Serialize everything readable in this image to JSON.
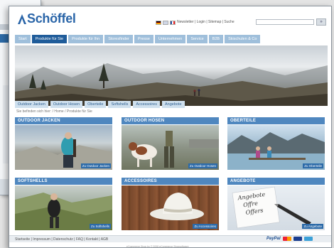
{
  "header": {
    "brand": "Schöffel",
    "util_links": "Newsletter | Login | Sitemap | Suche",
    "search_placeholder": "",
    "search_button": "»"
  },
  "nav": {
    "items": [
      {
        "label": "Start"
      },
      {
        "label": "Produkte für Sie"
      },
      {
        "label": "Produkte für Ihn"
      },
      {
        "label": "Storesfinder"
      },
      {
        "label": "Presse"
      },
      {
        "label": "Unternehmen"
      },
      {
        "label": "Service"
      },
      {
        "label": "B2B"
      },
      {
        "label": "Skischulen & Co"
      }
    ],
    "active_index": 1
  },
  "sub_nav": {
    "items": [
      {
        "label": "Outdoor Jacken"
      },
      {
        "label": "Outdoor Hosen"
      },
      {
        "label": "Oberteile"
      },
      {
        "label": "Softshells"
      },
      {
        "label": "Accessoires"
      },
      {
        "label": "Angebote"
      }
    ]
  },
  "breadcrumb": "Sie befinden sich hier: / Home / Produkte für Sie",
  "tiles": [
    {
      "title": "OUTDOOR JACKEN",
      "link": "Zu Outdoor Jacken"
    },
    {
      "title": "OUTDOOR HOSEN",
      "link": "Zu Outdoor Hosen"
    },
    {
      "title": "OBERTEILE",
      "link": "Zu Oberteile"
    },
    {
      "title": "SOFTSHELLS",
      "link": "Zu Softshells"
    },
    {
      "title": "ACCESSOIRES",
      "link": "Zu Accessoires"
    },
    {
      "title": "ANGEBOTE",
      "link": "Zu Angebote",
      "sign_lines": [
        "Angebote",
        "Offre",
        "Offers"
      ]
    }
  ],
  "footer": {
    "links": "Startseite | Impressum | Datenschutz | FAQ | Kontakt | AGB",
    "paypal": "PayPal",
    "copyright": "eCommerce Shop by © 2008 eCommerce Shopsoftware"
  },
  "colors": {
    "brand_blue": "#2a65a8",
    "nav_active": "#1f5c9a",
    "nav_inactive": "#9fbfdb",
    "tile_header": "#4f87bf"
  }
}
